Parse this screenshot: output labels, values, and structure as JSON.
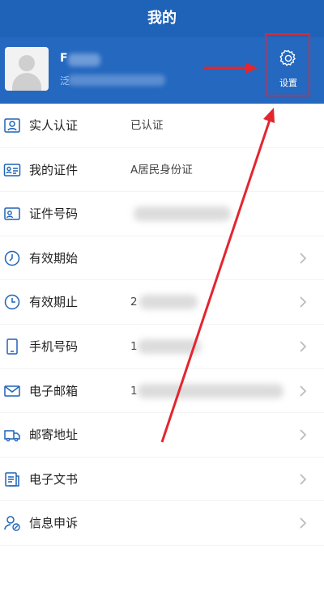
{
  "header": {
    "title": "我的"
  },
  "profile": {
    "name_initial": "F",
    "desc_initial": "泛",
    "settings_label": "设置"
  },
  "menu": [
    {
      "label": "实人认证",
      "value": "已认证",
      "icon": "person-card-icon"
    },
    {
      "label": "我的证件",
      "value": "A居民身份证",
      "icon": "id-card-icon"
    },
    {
      "label": "证件号码",
      "value": "",
      "icon": "id-photo-icon"
    },
    {
      "label": "有效期始",
      "value": "",
      "icon": "clock-icon"
    },
    {
      "label": "有效期止",
      "value": "2",
      "icon": "clock-icon"
    },
    {
      "label": "手机号码",
      "value": "1",
      "icon": "phone-icon"
    },
    {
      "label": "电子邮箱",
      "value": "1",
      "icon": "mail-icon"
    },
    {
      "label": "邮寄地址",
      "value": "",
      "icon": "truck-icon"
    },
    {
      "label": "电子文书",
      "value": "",
      "icon": "document-icon"
    },
    {
      "label": "信息申诉",
      "value": "",
      "icon": "user-edit-icon"
    }
  ],
  "colors": {
    "header": "#1f63b8",
    "icon": "#1f63b8",
    "annotation": "#e3262e"
  }
}
